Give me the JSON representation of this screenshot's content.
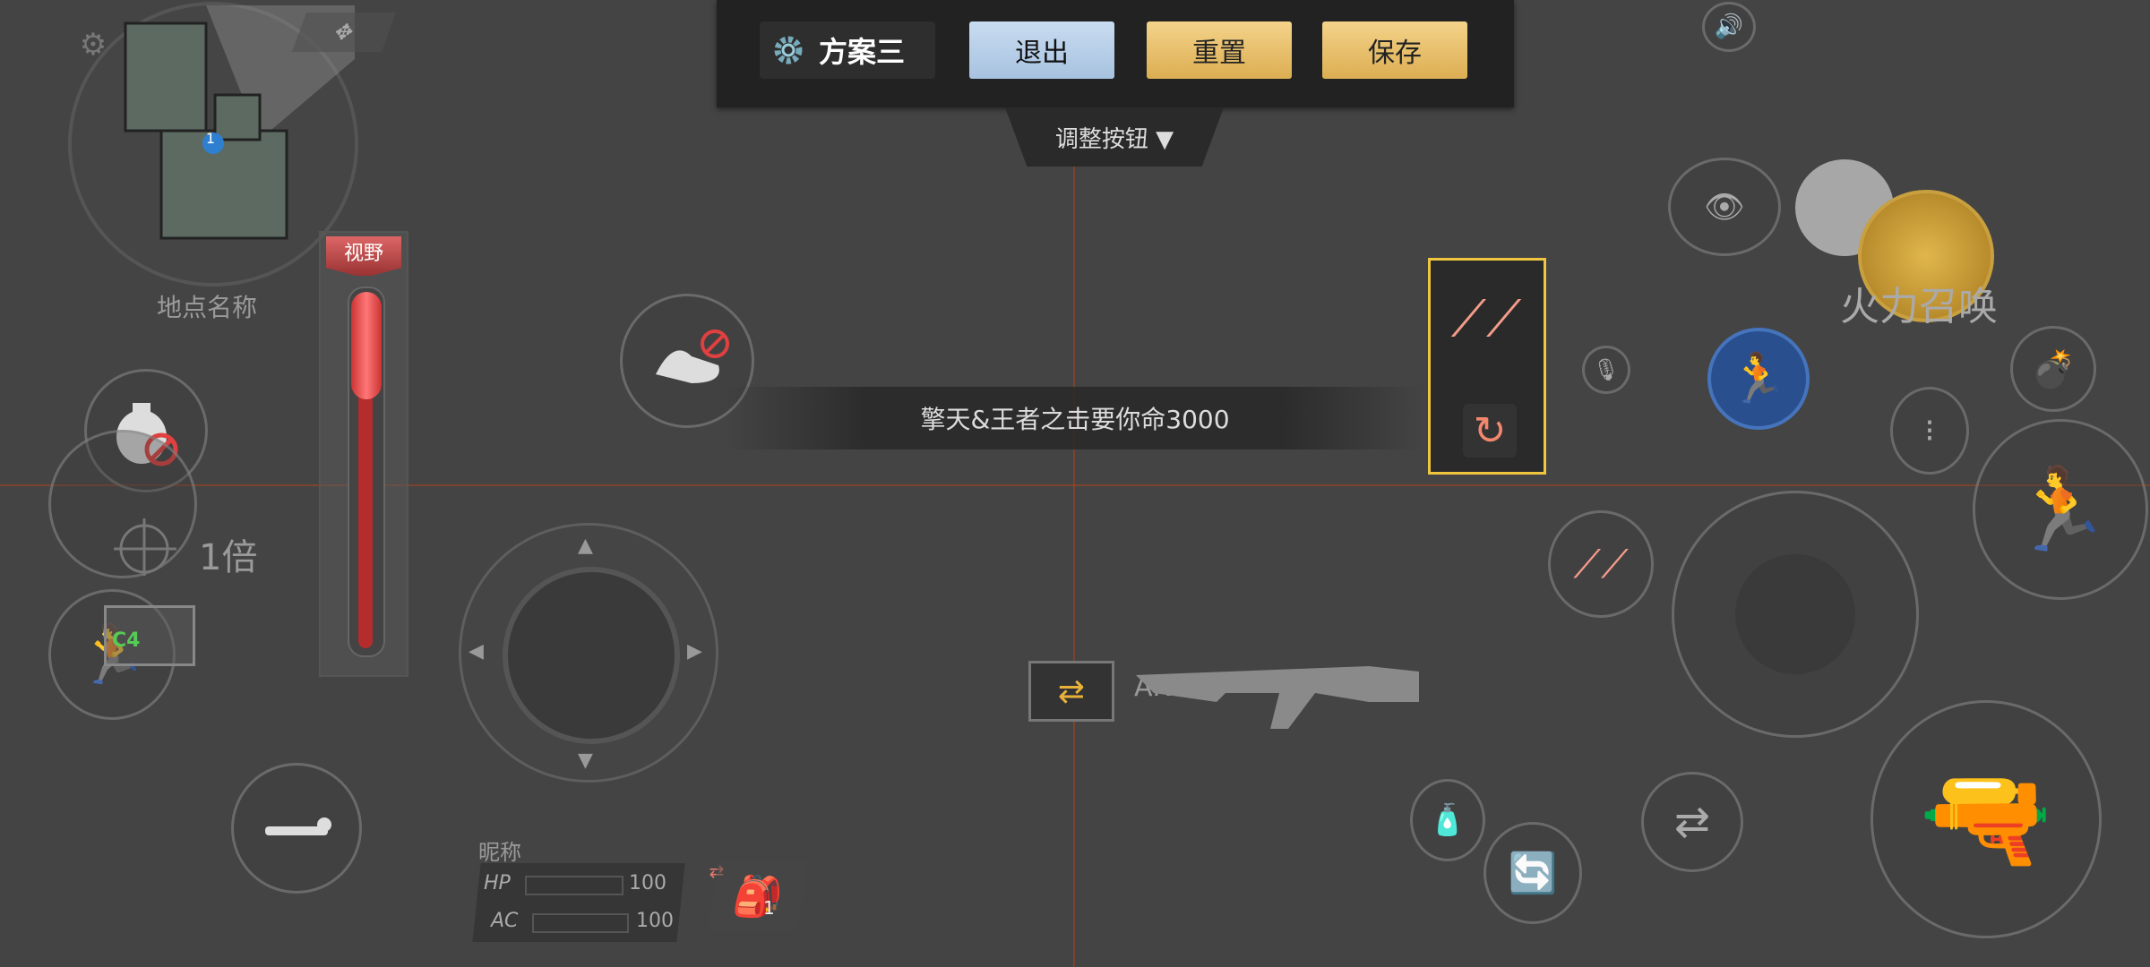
{
  "topbar": {
    "scheme_name": "方案三",
    "exit_label": "退出",
    "reset_label": "重置",
    "save_label": "保存"
  },
  "adjust_label": "调整按钮 ▼",
  "minimap": {
    "location_name": "地点名称",
    "player_marker": "1"
  },
  "fov": {
    "label": "视野"
  },
  "scope": {
    "zoom": "1倍"
  },
  "banner": {
    "text": "擎天&王者之击要你命3000"
  },
  "weapon": {
    "name": "AK47"
  },
  "player": {
    "nickname": "昵称",
    "hp_label": "HP",
    "hp_value": "100",
    "ac_label": "AC",
    "ac_value": "100",
    "backpack_count": "1"
  },
  "firepower": {
    "label": "火力召唤"
  },
  "battery_label": "C4",
  "colors": {
    "accent_gold": "#dcae52",
    "exit_blue": "#a7c2e0",
    "selection": "#f0c640"
  }
}
